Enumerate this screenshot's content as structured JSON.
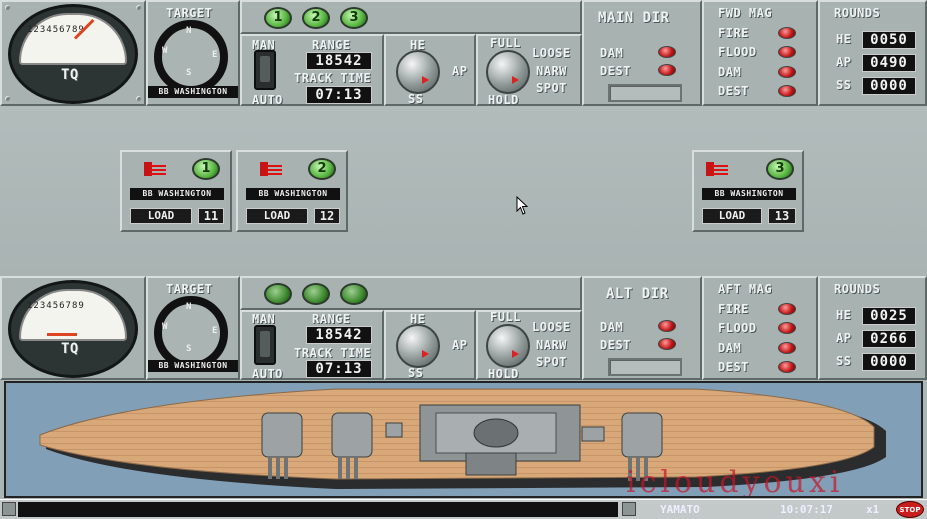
{
  "top_console": {
    "gauge_label": "TQ",
    "gauge_scale": [
      "1",
      "2",
      "3",
      "4",
      "5",
      "6",
      "7",
      "8",
      "9"
    ],
    "target_label": "TARGET",
    "target_ship": "BB WASHINGTON",
    "compass": {
      "n": "N",
      "e": "E",
      "s": "S",
      "w": "W"
    },
    "turret_buttons": [
      "1",
      "2",
      "3"
    ],
    "man_label": "MAN",
    "auto_label": "AUTO",
    "range_label": "RANGE",
    "range_value": "18542",
    "track_time_label": "TRACK TIME",
    "track_time_value": "07:13",
    "ammo_he": "HE",
    "ammo_ap": "AP",
    "ammo_ss": "SS",
    "spread_full": "FULL",
    "spread_loose": "LOOSE",
    "spread_narw": "NARW",
    "spread_spot": "SPOT",
    "spread_hold": "HOLD",
    "director_title": "MAIN DIR",
    "dir_dam": "DAM",
    "dir_dest": "DEST",
    "mag_title": "FWD MAG",
    "mag_items": [
      "FIRE",
      "FLOOD",
      "DAM",
      "DEST"
    ],
    "rounds_title": "ROUNDS",
    "rounds": [
      {
        "type": "HE",
        "value": "0050"
      },
      {
        "type": "AP",
        "value": "0490"
      },
      {
        "type": "SS",
        "value": "0000"
      }
    ]
  },
  "turrets": [
    {
      "number": "1",
      "target": "BB WASHINGTON",
      "load_label": "LOAD",
      "load_value": "11"
    },
    {
      "number": "2",
      "target": "BB WASHINGTON",
      "load_label": "LOAD",
      "load_value": "12"
    },
    {
      "number": "3",
      "target": "BB WASHINGTON",
      "load_label": "LOAD",
      "load_value": "13"
    }
  ],
  "bottom_console": {
    "gauge_label": "TQ",
    "target_label": "TARGET",
    "target_ship": "BB WASHINGTON",
    "compass": {
      "n": "N",
      "e": "E",
      "s": "S",
      "w": "W"
    },
    "man_label": "MAN",
    "auto_label": "AUTO",
    "range_label": "RANGE",
    "range_value": "18542",
    "track_time_label": "TRACK TIME",
    "track_time_value": "07:13",
    "ammo_he": "HE",
    "ammo_ap": "AP",
    "ammo_ss": "SS",
    "spread_full": "FULL",
    "spread_loose": "LOOSE",
    "spread_narw": "NARW",
    "spread_spot": "SPOT",
    "spread_hold": "HOLD",
    "director_title": "ALT DIR",
    "dir_dam": "DAM",
    "dir_dest": "DEST",
    "mag_title": "AFT MAG",
    "mag_items": [
      "FIRE",
      "FLOOD",
      "DAM",
      "DEST"
    ],
    "rounds_title": "ROUNDS",
    "rounds": [
      {
        "type": "HE",
        "value": "0025"
      },
      {
        "type": "AP",
        "value": "0266"
      },
      {
        "type": "SS",
        "value": "0000"
      }
    ]
  },
  "status_bar": {
    "ship_name": "YAMATO",
    "clock": "10:07:17",
    "time_scale": "x1",
    "stop_label": "STOP"
  },
  "watermark": "icloudyouxi",
  "colors": {
    "panel": "#a8b2b1",
    "warning_light": "#c21717",
    "turret_green": "#55b43e",
    "deck": "#d9a878",
    "water": "#6f8fa8"
  }
}
